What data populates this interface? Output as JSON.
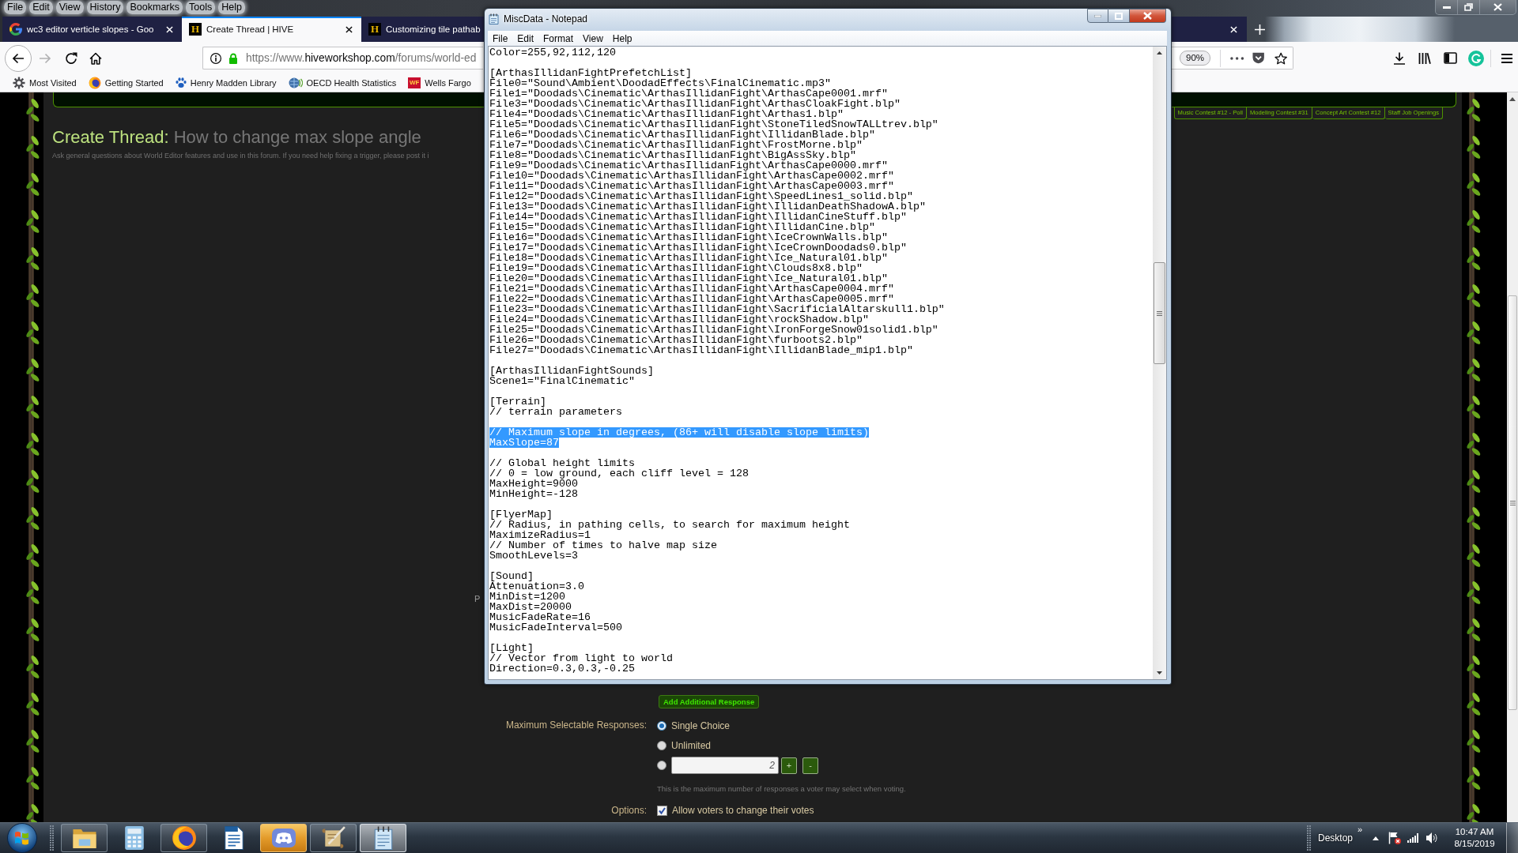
{
  "browser": {
    "menu": [
      "File",
      "Edit",
      "View",
      "History",
      "Bookmarks",
      "Tools",
      "Help"
    ],
    "tabs": [
      {
        "title": "wc3 editor verticle slopes - Goo",
        "kind": "search",
        "selected": false
      },
      {
        "title": "Create Thread | HIVE",
        "kind": "site",
        "logo": "H",
        "selected": true
      },
      {
        "title": "Customizing tile pathab",
        "kind": "site",
        "logo": "H",
        "selected": false
      }
    ],
    "nav_buttons": [
      {
        "kind": "back",
        "disabled": false
      },
      {
        "kind": "forward",
        "disabled": true
      },
      {
        "kind": "reload",
        "disabled": false
      },
      {
        "kind": "home",
        "disabled": false
      }
    ],
    "address": {
      "scheme": "https://www.",
      "domain": "hiveworkshop.com",
      "path": "/forums/world-ed"
    },
    "zoom": "90%",
    "bookmarks": [
      {
        "label": "Most Visited",
        "kind": "gear"
      },
      {
        "label": "Getting Started",
        "kind": "browser"
      },
      {
        "label": "Henry Madden Library",
        "kind": "paw"
      },
      {
        "label": "OECD Health Statistics",
        "kind": "globe"
      },
      {
        "label": "Wells Fargo",
        "kind": "lettermark",
        "logo": "WF"
      }
    ]
  },
  "page": {
    "top_links": [
      "Music Contest #12 - Poll",
      "Modeling Contest #31",
      "Concept Art Contest #12",
      "Staff Job Openings"
    ],
    "heading_lead": "Create Thread:",
    "heading": "How to change max slope angle",
    "description": "Ask general questions about World Editor features and use in this forum. If you need help fixing a trigger, please post it i",
    "partial_label": "P",
    "add_button": "Add Additional Response",
    "fields": [
      {
        "label": "Maximum Selectable Responses:",
        "kind": "radio",
        "options": [
          {
            "kind": "text",
            "label": "Single Choice",
            "selected": true
          },
          {
            "kind": "text",
            "label": "Unlimited",
            "selected": false
          },
          {
            "kind": "number",
            "value": "2",
            "plus": "+",
            "minus": "-",
            "selected": false
          }
        ],
        "hint": "This is the maximum number of responses a voter may select when voting."
      },
      {
        "label": "Options:",
        "kind": "checkbox",
        "options": [
          {
            "label": "Allow voters to change their votes",
            "checked": true
          }
        ]
      }
    ]
  },
  "notepad": {
    "title": "MiscData - Notepad",
    "menu": [
      "File",
      "Edit",
      "Format",
      "View",
      "Help"
    ],
    "blocks": [
      {
        "lines": [
          {
            "text": "Color=255,92,112,120",
            "selected": false
          }
        ]
      },
      {
        "lines": [
          {
            "text": "[ArthasIllidanFightPrefetchList]",
            "selected": false
          },
          {
            "text": "File0=\"Sound\\Ambient\\DoodadEffects\\FinalCinematic.mp3\"",
            "selected": false
          },
          {
            "text": "File1=\"Doodads\\Cinematic\\ArthasIllidanFight\\ArthasCape0001.mrf\"",
            "selected": false
          },
          {
            "text": "File3=\"Doodads\\Cinematic\\ArthasIllidanFight\\ArthasCloakFight.blp\"",
            "selected": false
          },
          {
            "text": "File4=\"Doodads\\Cinematic\\ArthasIllidanFight\\Arthas1.blp\"",
            "selected": false
          },
          {
            "text": "File5=\"Doodads\\Cinematic\\ArthasIllidanFight\\StoneTiledSnowTALLtrev.blp\"",
            "selected": false
          },
          {
            "text": "File6=\"Doodads\\Cinematic\\ArthasIllidanFight\\IllidanBlade.blp\"",
            "selected": false
          },
          {
            "text": "File7=\"Doodads\\Cinematic\\ArthasIllidanFight\\FrostMorne.blp\"",
            "selected": false
          },
          {
            "text": "File8=\"Doodads\\Cinematic\\ArthasIllidanFight\\BigAssSky.blp\"",
            "selected": false
          },
          {
            "text": "File9=\"Doodads\\Cinematic\\ArthasIllidanFight\\ArthasCape0000.mrf\"",
            "selected": false
          },
          {
            "text": "File10=\"Doodads\\Cinematic\\ArthasIllidanFight\\ArthasCape0002.mrf\"",
            "selected": false
          },
          {
            "text": "File11=\"Doodads\\Cinematic\\ArthasIllidanFight\\ArthasCape0003.mrf\"",
            "selected": false
          },
          {
            "text": "File12=\"Doodads\\Cinematic\\ArthasIllidanFight\\SpeedLines1_solid.blp\"",
            "selected": false
          },
          {
            "text": "File13=\"Doodads\\Cinematic\\ArthasIllidanFight\\IllidanDeathShadowA.blp\"",
            "selected": false
          },
          {
            "text": "File14=\"Doodads\\Cinematic\\ArthasIllidanFight\\IllidanCineStuff.blp\"",
            "selected": false
          },
          {
            "text": "File15=\"Doodads\\Cinematic\\ArthasIllidanFight\\IllidanCine.blp\"",
            "selected": false
          },
          {
            "text": "File16=\"Doodads\\Cinematic\\ArthasIllidanFight\\IceCrownWalls.blp\"",
            "selected": false
          },
          {
            "text": "File17=\"Doodads\\Cinematic\\ArthasIllidanFight\\IceCrownDoodads0.blp\"",
            "selected": false
          },
          {
            "text": "File18=\"Doodads\\Cinematic\\ArthasIllidanFight\\Ice_Natural01.blp\"",
            "selected": false
          },
          {
            "text": "File19=\"Doodads\\Cinematic\\ArthasIllidanFight\\Clouds8x8.blp\"",
            "selected": false
          },
          {
            "text": "File20=\"Doodads\\Cinematic\\ArthasIllidanFight\\Ice_Natural01.blp\"",
            "selected": false
          },
          {
            "text": "File21=\"Doodads\\Cinematic\\ArthasIllidanFight\\ArthasCape0004.mrf\"",
            "selected": false
          },
          {
            "text": "File22=\"Doodads\\Cinematic\\ArthasIllidanFight\\ArthasCape0005.mrf\"",
            "selected": false
          },
          {
            "text": "File23=\"Doodads\\Cinematic\\ArthasIllidanFight\\SacrificialAltarskull1.blp\"",
            "selected": false
          },
          {
            "text": "File24=\"Doodads\\Cinematic\\ArthasIllidanFight\\rockShadow.blp\"",
            "selected": false
          },
          {
            "text": "File25=\"Doodads\\Cinematic\\ArthasIllidanFight\\IronForgeSnow01solid1.blp\"",
            "selected": false
          },
          {
            "text": "File26=\"Doodads\\Cinematic\\ArthasIllidanFight\\furboots2.blp\"",
            "selected": false
          },
          {
            "text": "File27=\"Doodads\\Cinematic\\ArthasIllidanFight\\IllidanBlade_mip1.blp\"",
            "selected": false
          }
        ]
      },
      {
        "lines": [
          {
            "text": "[ArthasIllidanFightSounds]",
            "selected": false
          },
          {
            "text": "Scene1=\"FinalCinematic\"",
            "selected": false
          }
        ]
      },
      {
        "lines": [
          {
            "text": "[Terrain]",
            "selected": false
          },
          {
            "text": "// terrain parameters",
            "selected": false
          }
        ]
      },
      {
        "lines": [
          {
            "text": "// Maximum slope in degrees, (86+ will disable slope limits)",
            "selected": true
          },
          {
            "text": "MaxSlope=87",
            "selected": true
          }
        ]
      },
      {
        "lines": [
          {
            "text": "// Global height limits",
            "selected": false
          },
          {
            "text": "// 0 = low ground, each cliff level = 128",
            "selected": false
          },
          {
            "text": "MaxHeight=9000",
            "selected": false
          },
          {
            "text": "MinHeight=-128",
            "selected": false
          }
        ]
      },
      {
        "lines": [
          {
            "text": "[FlyerMap]",
            "selected": false
          },
          {
            "text": "// Radius, in pathing cells, to search for maximum height",
            "selected": false
          },
          {
            "text": "MaximizeRadius=1",
            "selected": false
          },
          {
            "text": "// Number of times to halve map size",
            "selected": false
          },
          {
            "text": "SmoothLevels=3",
            "selected": false
          }
        ]
      },
      {
        "lines": [
          {
            "text": "[Sound]",
            "selected": false
          },
          {
            "text": "Attenuation=3.0",
            "selected": false
          },
          {
            "text": "MinDist=1200",
            "selected": false
          },
          {
            "text": "MaxDist=20000",
            "selected": false
          },
          {
            "text": "MusicFadeRate=16",
            "selected": false
          },
          {
            "text": "MusicFadeInterval=500",
            "selected": false
          }
        ]
      },
      {
        "lines": [
          {
            "text": "[Light]",
            "selected": false
          },
          {
            "text": "// Vector from light to world",
            "selected": false
          },
          {
            "text": "Direction=0.3,0.3,-0.25",
            "selected": false
          }
        ]
      }
    ]
  },
  "taskbar": {
    "apps": [
      {
        "kind": "folder",
        "running": true,
        "active": false,
        "highlighted": false
      },
      {
        "kind": "calculator",
        "running": false,
        "active": false,
        "highlighted": false
      },
      {
        "kind": "browser",
        "running": true,
        "active": false,
        "highlighted": false
      },
      {
        "kind": "document",
        "running": false,
        "active": false,
        "highlighted": false
      },
      {
        "kind": "chat",
        "running": true,
        "active": false,
        "highlighted": true
      },
      {
        "kind": "editor",
        "running": true,
        "active": false,
        "highlighted": false
      },
      {
        "kind": "notepad",
        "running": true,
        "active": true,
        "highlighted": false
      }
    ],
    "toolbar_label": "Desktop",
    "chevron": "»",
    "time": "10:47 AM",
    "date": "8/15/2019"
  }
}
